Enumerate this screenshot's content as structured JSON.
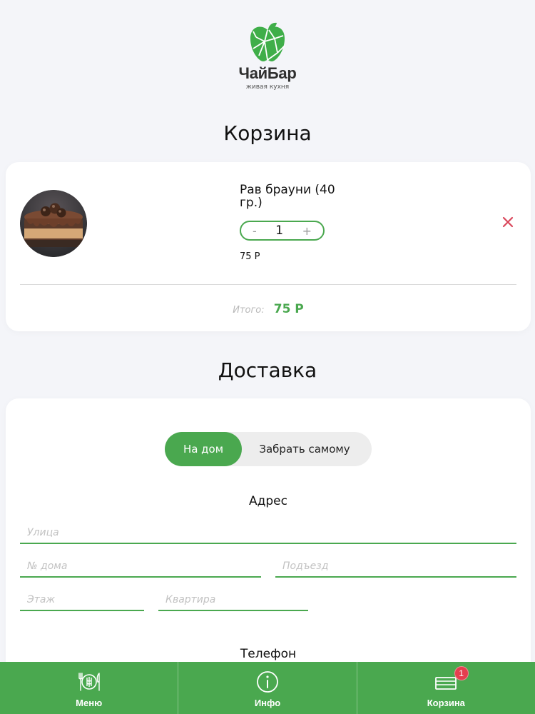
{
  "brand": {
    "name": "ЧайБар",
    "tagline": "живая кухня",
    "logo_icon": "green-apple-logo",
    "accent_color": "#4aa84f"
  },
  "cart": {
    "title": "Корзина",
    "items": [
      {
        "name": "Рав брауни (40 гр.)",
        "quantity": "1",
        "price": "75 Р",
        "decrement": "-",
        "increment": "+",
        "remove_icon": "close-icon",
        "photo": "chocolate-cake-photo"
      }
    ],
    "total_label": "Итого:",
    "total_value": "75 Р"
  },
  "delivery": {
    "title": "Доставка",
    "options": [
      "На дом",
      "Забрать самому"
    ],
    "selected_option": "На дом",
    "address_label": "Адрес",
    "fields": {
      "street": "Улица",
      "house": "№ дома",
      "entrance": "Подъезд",
      "floor": "Этаж",
      "apartment": "Квартира"
    },
    "phone_label": "Телефон"
  },
  "nav": {
    "items": [
      {
        "label": "Меню",
        "icon": "menu-cutlery-icon"
      },
      {
        "label": "Инфо",
        "icon": "info-icon"
      },
      {
        "label": "Корзина",
        "icon": "cart-icon",
        "badge": "1"
      }
    ],
    "badge_color": "#e53e4f"
  }
}
